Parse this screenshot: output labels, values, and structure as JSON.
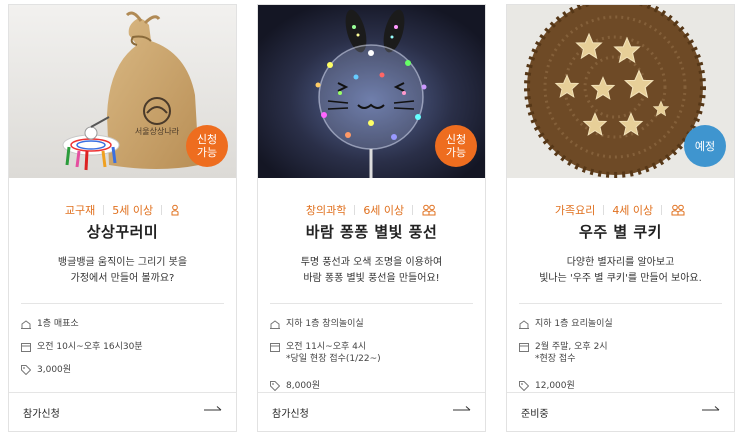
{
  "cards": [
    {
      "category": "교구재",
      "age": "5세 이상",
      "badge": "신청\n가능",
      "badge_color": "#ee6d1f",
      "title": "상상꾸러미",
      "desc1": "뱅글뱅글 움직이는 그리기 봇을",
      "desc2": "가정에서 만들어 볼까요?",
      "location": "1층 매표소",
      "time": "오전 10시~오후 16시30분",
      "time_note": "",
      "price": "3,000원",
      "action": "참가신청",
      "bag_brand": "서울상상나라"
    },
    {
      "category": "창의과학",
      "age": "6세 이상",
      "badge": "신청\n가능",
      "badge_color": "#ee6d1f",
      "title": "바람 퐁퐁 별빛 풍선",
      "desc1": "투명 풍선과 오색 조명을 이용하여",
      "desc2": "바람 퐁퐁 별빛 풍선을 만들어요!",
      "location": "지하 1층 창의놀이실",
      "time": "오전 11시~오후 4시",
      "time_note": "*당일 현장 접수(1/22~)",
      "price": "8,000원",
      "action": "참가신청"
    },
    {
      "category": "가족요리",
      "age": "4세 이상",
      "badge": "예정",
      "badge_color": "#3f95cf",
      "title": "우주 별 쿠키",
      "desc1": "다양한 별자리를 알아보고",
      "desc2": "빛나는 '우주 별 쿠키'를 만들어 보아요.",
      "location": "지하 1층 요리놀이실",
      "time": "2월 주말, 오후 2시",
      "time_note": "*현장 접수",
      "price": "12,000원",
      "action": "준비중"
    }
  ],
  "icons": {
    "people": "people-icon",
    "location": "location-icon",
    "calendar": "calendar-icon",
    "price": "price-tag-icon",
    "arrow": "arrow-right-icon"
  }
}
